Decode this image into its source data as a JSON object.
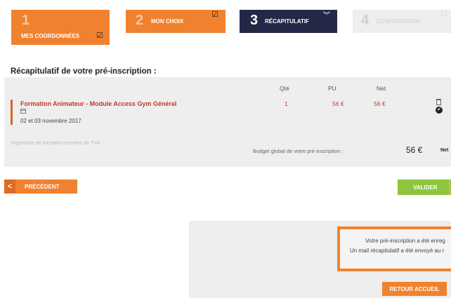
{
  "steps": [
    {
      "number": "1",
      "label": "MES COORDONNÉES",
      "state": "done",
      "icon": "checkbox-checked-icon"
    },
    {
      "number": "2",
      "label": "MON CHOIX",
      "state": "done",
      "icon": "checkbox-checked-icon"
    },
    {
      "number": "3",
      "label": "RÉCAPITULATIF",
      "state": "active",
      "icon": "double-chevron-down-icon"
    },
    {
      "number": "4",
      "label": "CONFIRMATION",
      "state": "inactive",
      "icon": "checkbox-icon"
    }
  ],
  "summary": {
    "title": "Récapitulatif de votre pré-inscription :",
    "headers": {
      "qty": "Qté",
      "unit_price": "PU",
      "net": "Net"
    },
    "items": [
      {
        "title": "Formation Animateur - Module Access Gym Général",
        "date": "02 et 03 novembre 2017",
        "qty": "1",
        "unit_price": "56 €",
        "net": "56 €"
      }
    ],
    "org_note": "Organisme de formation exonéré de TVA",
    "budget_label": "Budget global de votre pré-inscription :",
    "budget_value": "56 €",
    "budget_suffix": "Net"
  },
  "nav": {
    "prev_label": "PRÉCÉDENT",
    "prev_icon": "<",
    "validate_label": "VALIDER"
  },
  "confirmation": {
    "line1": "Votre pré-inscription a été enreg",
    "line2": "Un mail récapitulatif a été envoyé au r",
    "home_label": "RETOUR ACCUEIL"
  },
  "colors": {
    "orange": "#f0822f",
    "navy": "#222845",
    "green": "#8cc63f",
    "red_text": "#c0392b",
    "panel_grey": "#eeeeee"
  }
}
